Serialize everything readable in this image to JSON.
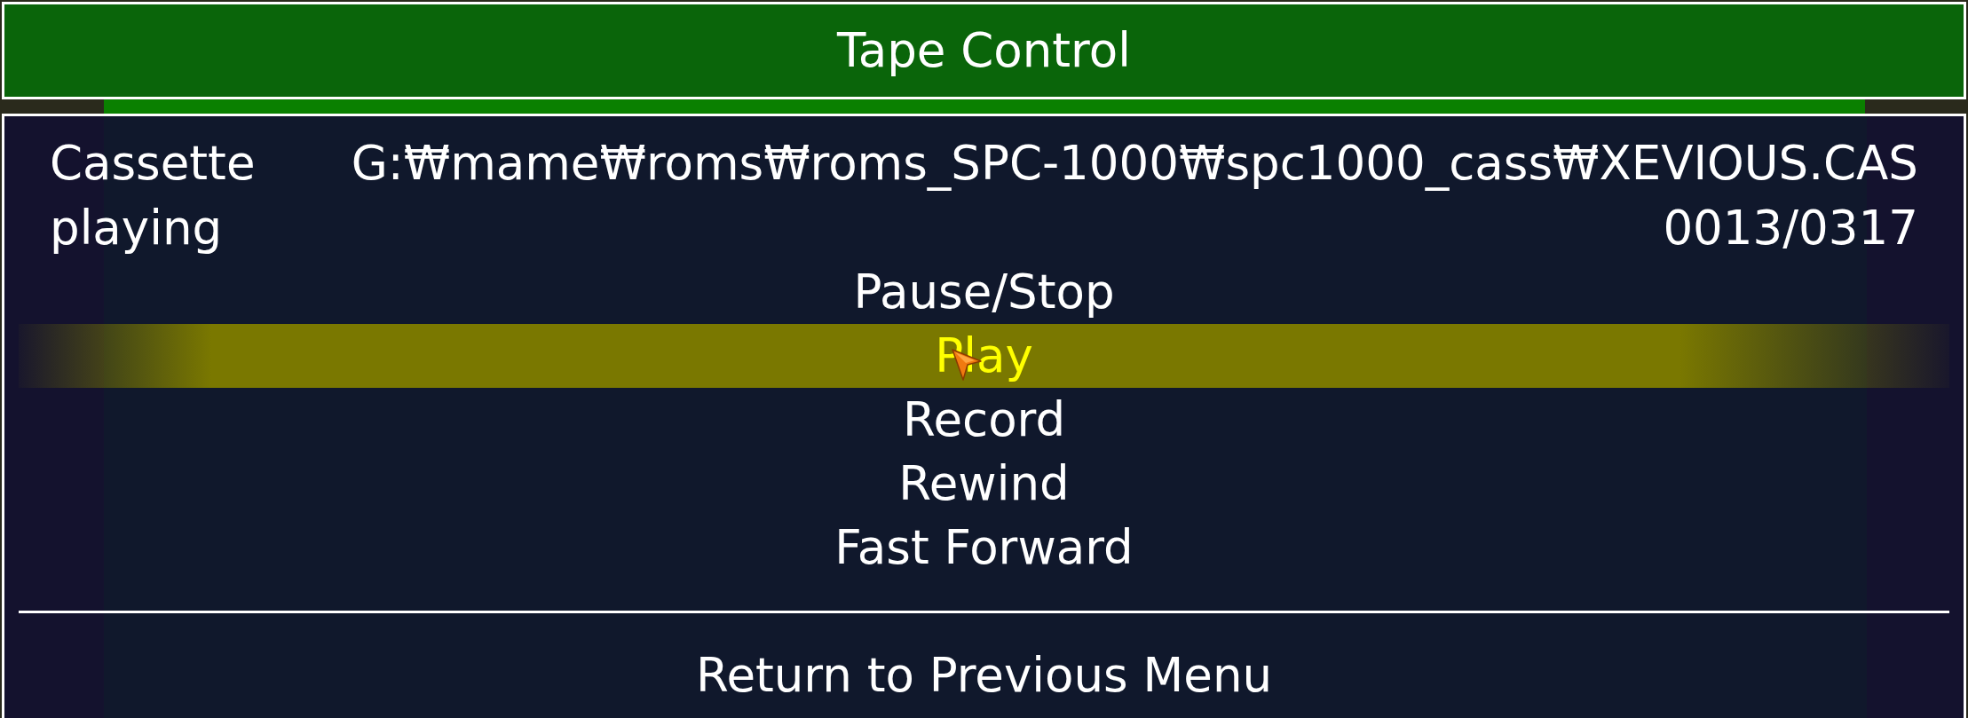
{
  "title": "Tape Control",
  "cassette": {
    "device": "Cassette",
    "file": "G:₩mame₩roms₩roms_SPC-1000₩spc1000_cass₩XEVIOUS.CAS",
    "status": "playing",
    "counter": "0013/0317"
  },
  "menu": [
    {
      "label": "Pause/Stop",
      "selected": false
    },
    {
      "label": "Play",
      "selected": true
    },
    {
      "label": "Record",
      "selected": false
    },
    {
      "label": "Rewind",
      "selected": false
    },
    {
      "label": "Fast Forward",
      "selected": false
    }
  ],
  "footer_menu": [
    {
      "label": "Return to Previous Menu",
      "selected": false
    }
  ]
}
